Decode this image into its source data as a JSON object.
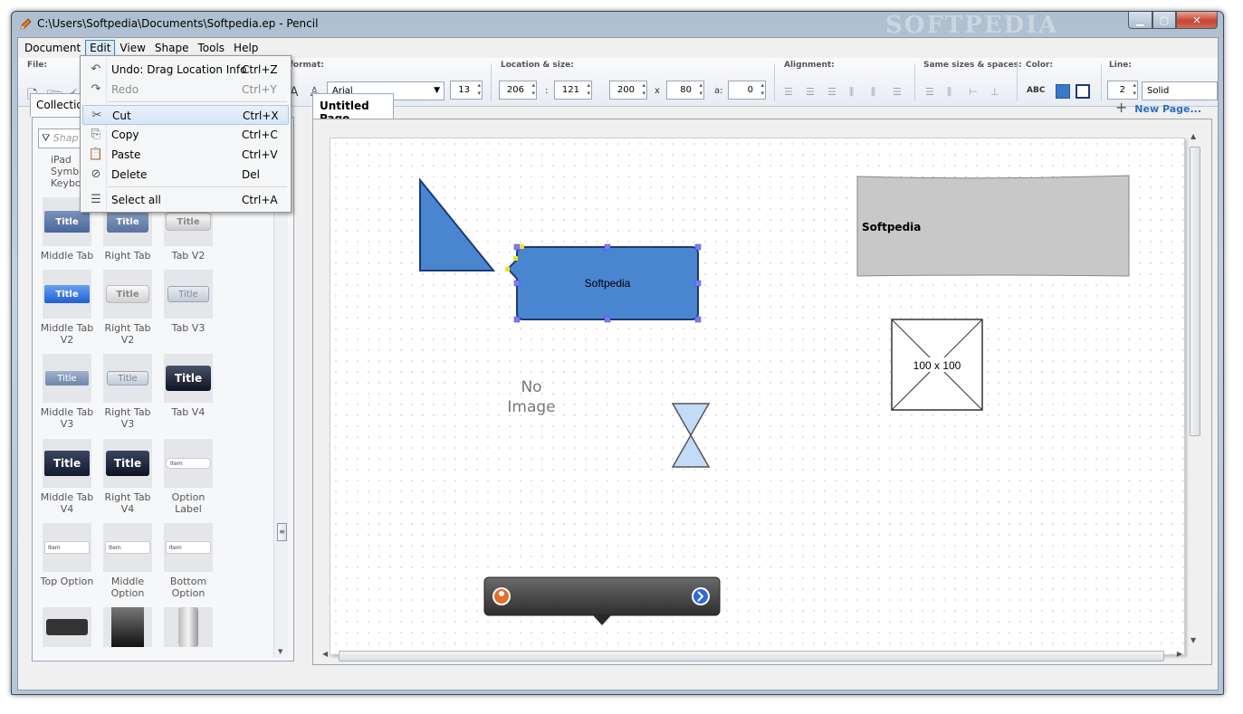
{
  "window": {
    "title": "C:\\Users\\Softpedia\\Documents\\Softpedia.ep - Pencil",
    "watermark": "SOFTPEDIA"
  },
  "menubar": {
    "items": [
      "Document",
      "Edit",
      "View",
      "Shape",
      "Tools",
      "Help"
    ]
  },
  "toolbar": {
    "file_label": "File:",
    "format_label": "format:",
    "font_family": "Arial",
    "font_size": "13",
    "location_label": "Location & size:",
    "x": "206",
    "y": "121",
    "width": "200",
    "height": "80",
    "angle": "0",
    "x_sep": ":",
    "size_sep": "x",
    "angle_label": "a:",
    "alignment_label": "Alignment:",
    "same_sizes_label": "Same sizes & spaces:",
    "color_label": "Color:",
    "abc": "ABC",
    "fill_color": "#3a78c9",
    "line_label": "Line:",
    "line_width": "2",
    "line_style": "Solid"
  },
  "context_menu": {
    "items": [
      {
        "icon": "undo-icon",
        "label": "Undo: Drag Location Info",
        "shortcut": "Ctrl+Z"
      },
      {
        "icon": "redo-icon",
        "label": "Redo",
        "shortcut": "Ctrl+Y"
      },
      {
        "icon": "cut-icon",
        "label": "Cut",
        "shortcut": "Ctrl+X"
      },
      {
        "icon": "copy-icon",
        "label": "Copy",
        "shortcut": "Ctrl+C"
      },
      {
        "icon": "paste-icon",
        "label": "Paste",
        "shortcut": "Ctrl+V"
      },
      {
        "icon": "delete-icon",
        "label": "Delete",
        "shortcut": "Del"
      },
      {
        "icon": "select-all-icon",
        "label": "Select all",
        "shortcut": "Ctrl+A"
      }
    ]
  },
  "left_panel": {
    "tab": "Collectio",
    "filter_placeholder": "Shap",
    "partial_label": "iPad\nSymb\nKeybo",
    "shapes": [
      {
        "label": "Middle Tab",
        "thumb_text": "Title"
      },
      {
        "label": "Right Tab",
        "thumb_text": "Title"
      },
      {
        "label": "Tab V2",
        "thumb_text": "Title"
      },
      {
        "label": "Middle Tab V2",
        "thumb_text": "Title"
      },
      {
        "label": "Right Tab V2",
        "thumb_text": "Title"
      },
      {
        "label": "Tab V3",
        "thumb_text": "Title"
      },
      {
        "label": "Middle Tab V3",
        "thumb_text": "Title"
      },
      {
        "label": "Right Tab V3",
        "thumb_text": "Title"
      },
      {
        "label": "Tab V4",
        "thumb_text": "Title"
      },
      {
        "label": "Middle Tab V4",
        "thumb_text": "Title"
      },
      {
        "label": "Right Tab V4",
        "thumb_text": "Title"
      },
      {
        "label": "Option Label",
        "thumb_text": "Item"
      },
      {
        "label": "Top Option",
        "thumb_text": "Item"
      },
      {
        "label": "Middle Option",
        "thumb_text": "Item"
      },
      {
        "label": "Bottom Option",
        "thumb_text": "Item"
      }
    ]
  },
  "canvas": {
    "page_tab": "Untitled Page",
    "new_page": "New Page...",
    "rect_text": "Softpedia",
    "sketch_text": "Softpedia",
    "no_image_line1": "No",
    "no_image_line2": "Image",
    "image_placeholder": "100 x 100"
  }
}
